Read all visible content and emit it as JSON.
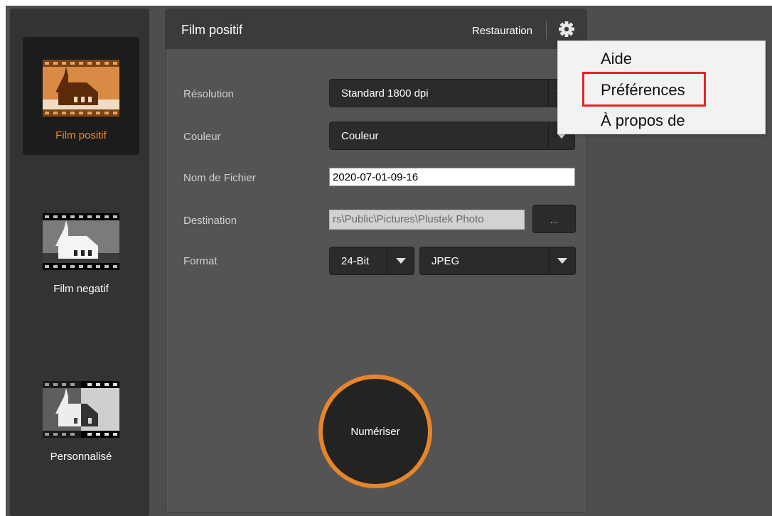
{
  "sidebar": {
    "modes": [
      {
        "label": "Film positif",
        "icon": "film-positive-icon",
        "active": true
      },
      {
        "label": "Film negatif",
        "icon": "film-negative-icon",
        "active": false
      },
      {
        "label": "Personnalisé",
        "icon": "film-custom-icon",
        "active": false
      }
    ]
  },
  "header": {
    "title": "Film positif",
    "restore_label": "Restauration",
    "settings_icon": "gear-icon"
  },
  "form": {
    "resolution": {
      "label": "Résolution",
      "value": "Standard 1800 dpi"
    },
    "color": {
      "label": "Couleur",
      "value": "Couleur"
    },
    "filename": {
      "label": "Nom de Fichier",
      "value": "2020-07-01-09-16"
    },
    "destination": {
      "label": "Destination",
      "value": "rs\\Public\\Pictures\\Plustek Photo",
      "browse_label": "..."
    },
    "format": {
      "label": "Format",
      "bit_depth": "24-Bit",
      "file_type": "JPEG"
    }
  },
  "scan_button": {
    "label": "Numériser"
  },
  "context_menu": {
    "items": [
      "Aide",
      "Préférences",
      "À propos de"
    ],
    "highlighted": "Préférences"
  },
  "colors": {
    "accent": "#e8852a",
    "highlight_box": "#e8202a",
    "panel": "#545454",
    "sidebar": "#333333"
  }
}
